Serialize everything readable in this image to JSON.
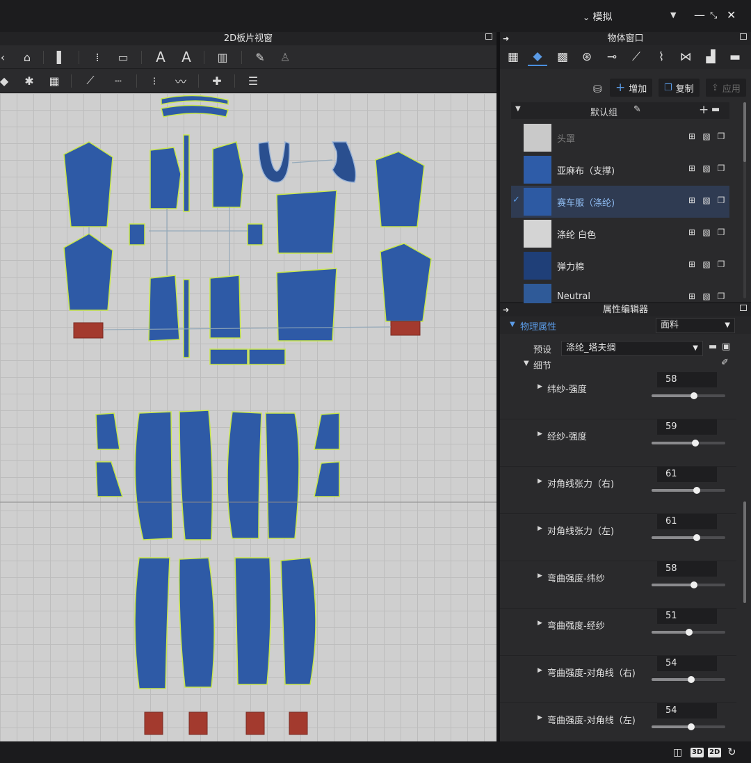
{
  "topbar": {
    "mode_label": "模拟",
    "dropdown_icon": "caret-down-icon"
  },
  "panel2d": {
    "title": "2D板片视窗"
  },
  "object_window": {
    "title": "物体窗口",
    "actions": {
      "add_label": "增加",
      "copy_label": "复制",
      "apply_label": "应用"
    },
    "group": {
      "name": "默认组"
    },
    "fabrics": [
      {
        "name": "头罩",
        "color": "#c9c9c9",
        "selected": false,
        "dim": true
      },
      {
        "name": "亚麻布（支撑)",
        "color": "#2e5ca8",
        "selected": false,
        "dim": false
      },
      {
        "name": "赛车服（涤纶)",
        "color": "#2d5aa3",
        "selected": true,
        "dim": false
      },
      {
        "name": "涤纶 白色",
        "color": "#d4d4d4",
        "selected": false,
        "dim": false
      },
      {
        "name": "弹力棉",
        "color": "#1f3f78",
        "selected": false,
        "dim": false
      },
      {
        "name": "Neutral",
        "color": "#2f5a98",
        "selected": false,
        "dim": false
      }
    ]
  },
  "property_editor": {
    "title": "属性编辑器",
    "section": "物理属性",
    "type_value": "面料",
    "preset_label": "预设",
    "preset_value": "涤纶_塔夫绸",
    "detail_label": "细节",
    "params": [
      {
        "label": "纬纱-强度",
        "value": "58",
        "level": 0.58
      },
      {
        "label": "经纱-强度",
        "value": "59",
        "level": 0.59
      },
      {
        "label": "对角线张力（右)",
        "value": "61",
        "level": 0.61
      },
      {
        "label": "对角线张力（左)",
        "value": "61",
        "level": 0.61
      },
      {
        "label": "弯曲强度-纬纱",
        "value": "58",
        "level": 0.58
      },
      {
        "label": "弯曲强度-经纱",
        "value": "51",
        "level": 0.51
      },
      {
        "label": "弯曲强度-对角线（右)",
        "value": "54",
        "level": 0.54
      },
      {
        "label": "弯曲强度-对角线（左)",
        "value": "54",
        "level": 0.54
      }
    ]
  },
  "statusbar": {
    "view_3d": "3D",
    "view_2d": "2D"
  },
  "colors": {
    "pattern_fill": "#2e5aa6",
    "pattern_outline": "#c8e64a",
    "point": "#f5e600",
    "trim": "#a33a2e",
    "accent": "#4a8fe0"
  }
}
